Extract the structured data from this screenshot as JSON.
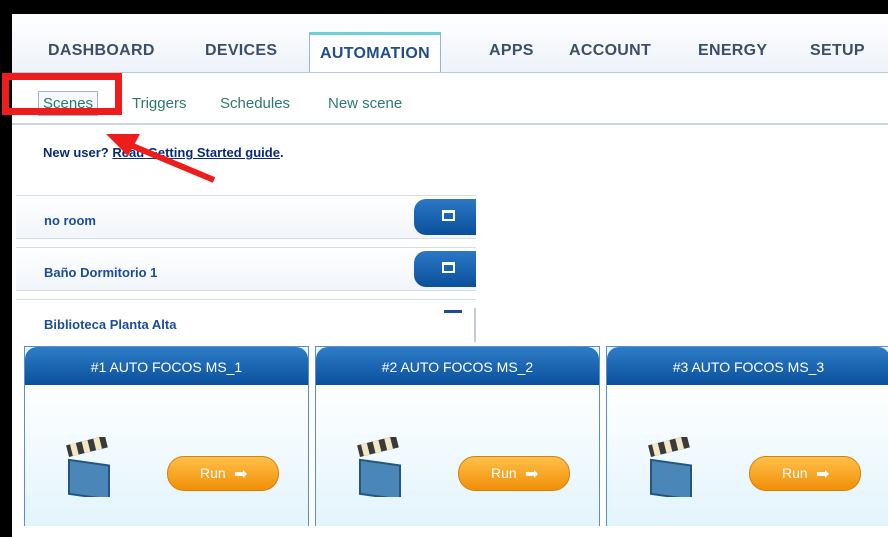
{
  "nav": {
    "items": [
      "DASHBOARD",
      "DEVICES",
      "AUTOMATION",
      "APPS",
      "ACCOUNT",
      "ENERGY",
      "SETUP"
    ]
  },
  "subnav": {
    "items": [
      "Scenes",
      "Triggers",
      "Schedules",
      "New scene"
    ]
  },
  "guide": {
    "prefix": "New user? ",
    "link": "Read Getting Started guide",
    "suffix": "."
  },
  "rooms": [
    {
      "name": "no room"
    },
    {
      "name": "Baño Dormitorio 1"
    },
    {
      "name": "Biblioteca Planta Alta"
    }
  ],
  "scenes": [
    {
      "title": "#1 AUTO FOCOS MS_1",
      "run_label": "Run"
    },
    {
      "title": "#2 AUTO FOCOS MS_2",
      "run_label": "Run"
    },
    {
      "title": "#3 AUTO FOCOS MS_3",
      "run_label": "Run"
    }
  ],
  "colors": {
    "highlight": "#ef1c1c",
    "nav_accent": "#6fd0d8",
    "room_button": "#1a66b5",
    "run_button": "#f5a41e"
  },
  "icons": [
    "clapperboard-icon",
    "arrow-right-icon",
    "maximize-icon",
    "minimize-icon"
  ]
}
